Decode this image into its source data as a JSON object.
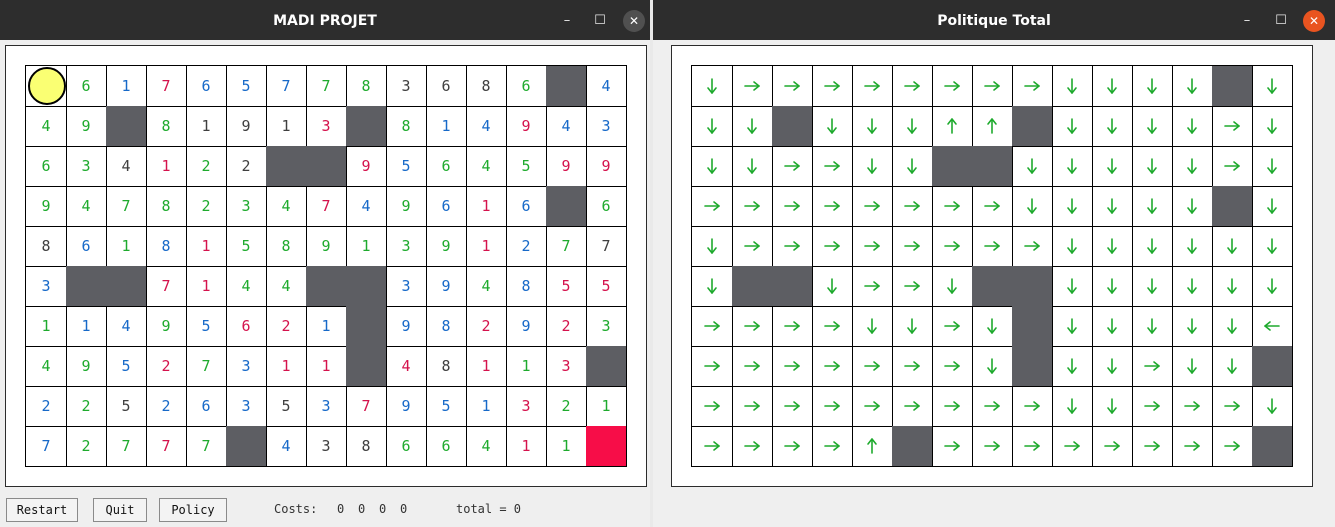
{
  "windows": {
    "left": {
      "title": "MADI PROJET",
      "controls": {
        "minimize": "–",
        "maximize": "☐",
        "close": "✕"
      }
    },
    "right": {
      "title": "Politique Total",
      "controls": {
        "minimize": "–",
        "maximize": "☐",
        "close": "✕"
      }
    }
  },
  "colors": {
    "g": "#1eaa2d",
    "b": "#1769c8",
    "r": "#d4124c",
    "k": "#3f3f3f",
    "wall": "#5d5e63",
    "goal": "#f70d48",
    "agent": "#faff73",
    "arrow": "#1eaa2d"
  },
  "grid_left": {
    "agent_cell": [
      0,
      0
    ],
    "rows": [
      [
        "A",
        "g6",
        "b1",
        "r7",
        "b6",
        "b5",
        "b7",
        "g7",
        "g8",
        "k3",
        "k6",
        "k8",
        "g6",
        "W",
        "b4"
      ],
      [
        "g4",
        "g9",
        "W",
        "g8",
        "k1",
        "k9",
        "k1",
        "r3",
        "W",
        "g8",
        "b1",
        "b4",
        "r9",
        "b4",
        "b3"
      ],
      [
        "g6",
        "g3",
        "k4",
        "r1",
        "g2",
        "k2",
        "W",
        "W",
        "r9",
        "b5",
        "g6",
        "g4",
        "g5",
        "r9",
        "r9"
      ],
      [
        "g9",
        "g4",
        "g7",
        "g8",
        "g2",
        "g3",
        "g4",
        "r7",
        "b4",
        "g9",
        "b6",
        "r1",
        "b6",
        "W",
        "g6"
      ],
      [
        "k8",
        "b6",
        "g1",
        "b8",
        "r1",
        "g5",
        "g8",
        "g9",
        "g1",
        "g3",
        "g9",
        "r1",
        "b2",
        "g7",
        "k7"
      ],
      [
        "b3",
        "W",
        "W",
        "r7",
        "r1",
        "g4",
        "g4",
        "W",
        "W",
        "b3",
        "b9",
        "g4",
        "b8",
        "r5",
        "r5"
      ],
      [
        "g1",
        "b1",
        "b4",
        "g9",
        "b5",
        "r6",
        "r2",
        "b1",
        "W",
        "b9",
        "b8",
        "r2",
        "b9",
        "r2",
        "g3"
      ],
      [
        "g4",
        "g9",
        "b5",
        "r2",
        "g7",
        "b3",
        "r1",
        "r1",
        "W",
        "r4",
        "k8",
        "r1",
        "g1",
        "r3",
        "W"
      ],
      [
        "b2",
        "g2",
        "k5",
        "b2",
        "b6",
        "b3",
        "k5",
        "b3",
        "r7",
        "b9",
        "b5",
        "b1",
        "r3",
        "g2",
        "g1"
      ],
      [
        "b7",
        "g2",
        "g7",
        "r7",
        "g7",
        "W",
        "b4",
        "k3",
        "k8",
        "g6",
        "g6",
        "g4",
        "r1",
        "g1",
        "G"
      ]
    ]
  },
  "grid_right": {
    "rows": [
      [
        "D",
        "R",
        "R",
        "R",
        "R",
        "R",
        "R",
        "R",
        "R",
        "D",
        "D",
        "D",
        "D",
        "W",
        "D"
      ],
      [
        "D",
        "D",
        "W",
        "D",
        "D",
        "D",
        "U",
        "U",
        "W",
        "D",
        "D",
        "D",
        "D",
        "R",
        "D"
      ],
      [
        "D",
        "D",
        "R",
        "R",
        "D",
        "D",
        "W",
        "W",
        "D",
        "D",
        "D",
        "D",
        "D",
        "R",
        "D"
      ],
      [
        "R",
        "R",
        "R",
        "R",
        "R",
        "R",
        "R",
        "R",
        "D",
        "D",
        "D",
        "D",
        "D",
        "W",
        "D"
      ],
      [
        "D",
        "R",
        "R",
        "R",
        "R",
        "R",
        "R",
        "R",
        "R",
        "D",
        "D",
        "D",
        "D",
        "D",
        "D"
      ],
      [
        "D",
        "W",
        "W",
        "D",
        "R",
        "R",
        "D",
        "W",
        "W",
        "D",
        "D",
        "D",
        "D",
        "D",
        "D"
      ],
      [
        "R",
        "R",
        "R",
        "R",
        "D",
        "D",
        "R",
        "D",
        "W",
        "D",
        "D",
        "D",
        "D",
        "D",
        "L"
      ],
      [
        "R",
        "R",
        "R",
        "R",
        "R",
        "R",
        "R",
        "D",
        "W",
        "D",
        "D",
        "R",
        "D",
        "D",
        "W"
      ],
      [
        "R",
        "R",
        "R",
        "R",
        "R",
        "R",
        "R",
        "R",
        "R",
        "D",
        "D",
        "R",
        "R",
        "R",
        "D"
      ],
      [
        "R",
        "R",
        "R",
        "R",
        "U",
        "W",
        "R",
        "R",
        "R",
        "R",
        "R",
        "R",
        "R",
        "R",
        "W"
      ]
    ]
  },
  "controls": {
    "restart_label": "Restart",
    "quit_label": "Quit",
    "policy_label": "Policy"
  },
  "costs": {
    "label": "Costs:",
    "green": "0",
    "blue": "0",
    "red": "0",
    "black": "0",
    "total_label": "total = 0"
  }
}
